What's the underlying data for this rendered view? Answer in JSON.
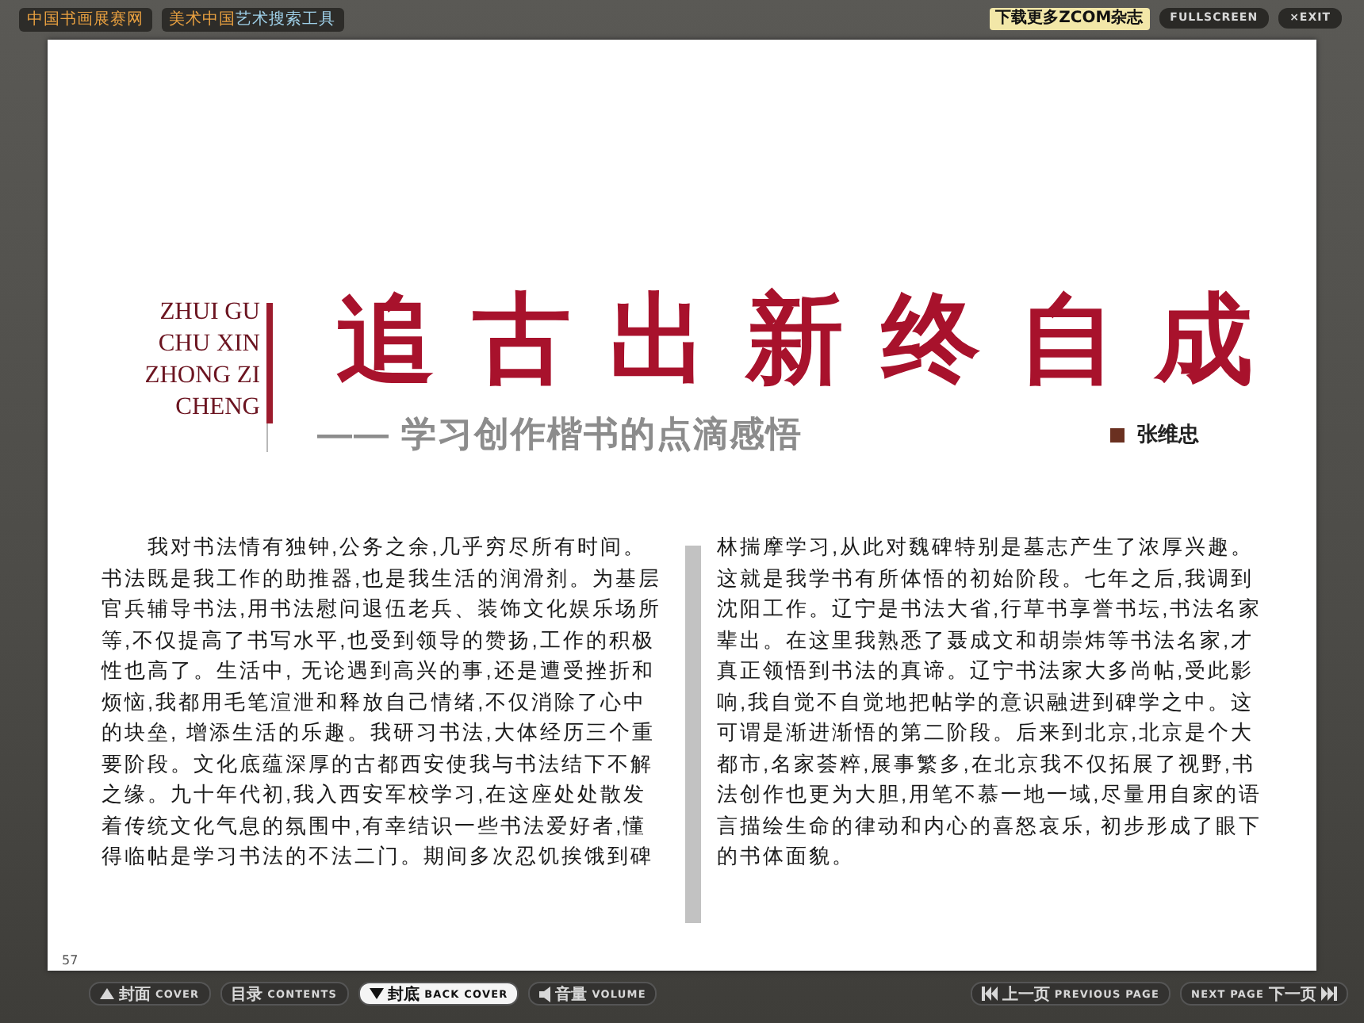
{
  "top_bar": {
    "left_links": [
      {
        "parts": [
          {
            "text": "中国书画展赛网",
            "color": "#e8a040"
          }
        ]
      },
      {
        "parts": [
          {
            "text": "美术中国",
            "color": "#e8a040"
          },
          {
            "text": "艺术搜索工具",
            "color": "#9fd0e8"
          }
        ]
      }
    ],
    "right_links": [
      {
        "label": "下载更多ZCOM杂志",
        "kind": "highlight"
      },
      {
        "label": "FULLSCREEN",
        "kind": "plain"
      },
      {
        "label": "×EXIT",
        "kind": "plain"
      }
    ]
  },
  "article": {
    "title_pinyin": [
      "ZHUI GU",
      "CHU XIN",
      "ZHONG ZI",
      "CHENG"
    ],
    "title": "追古出新终自成",
    "subtitle": "—— 学习创作楷书的点滴感悟",
    "author": "张维忠",
    "columns": [
      {
        "lines": [
          "我对书法情有独钟,公务之余,几乎穷尽所有时间。",
          "书法既是我工作的助推器,也是我生活的润滑剂。为基层",
          "官兵辅导书法,用书法慰问退伍老兵、装饰文化娱乐场所",
          "等,不仅提高了书写水平,也受到领导的赞扬,工作的积极",
          "性也高了。生活中, 无论遇到高兴的事,还是遭受挫折和",
          "烦恼,我都用毛笔渲泄和释放自己情绪,不仅消除了心中",
          "的块垒, 增添生活的乐趣。我研习书法,大体经历三个重",
          "要阶段。文化底蕴深厚的古都西安使我与书法结下不解",
          "之缘。九十年代初,我入西安军校学习,在这座处处散发",
          "着传统文化气息的氛围中,有幸结识一些书法爱好者,懂",
          "得临帖是学习书法的不法二门。期间多次忍饥挨饿到碑"
        ]
      },
      {
        "lines": [
          "林揣摩学习,从此对魏碑特别是墓志产生了浓厚兴趣。",
          "这就是我学书有所体悟的初始阶段。七年之后,我调到",
          "沈阳工作。辽宁是书法大省,行草书享誉书坛,书法名家",
          "辈出。在这里我熟悉了聂成文和胡崇炜等书法名家,才",
          "真正领悟到书法的真谛。辽宁书法家大多尚帖,受此影",
          "响,我自觉不自觉地把帖学的意识融进到碑学之中。这",
          "可谓是渐进渐悟的第二阶段。后来到北京,北京是个大",
          "都市,名家荟粹,展事繁多,在北京我不仅拓展了视野,书",
          "法创作也更为大胆,用笔不慕一地一域,尽量用自家的语",
          "言描绘生命的律动和内心的喜怒哀乐, 初步形成了眼下",
          "的书体面貌。"
        ]
      }
    ],
    "page_number": "57"
  },
  "bottom_nav": [
    {
      "kind": "up",
      "cn": "封面",
      "en": "COVER",
      "selected": false
    },
    {
      "kind": "plain",
      "cn": "目录",
      "en": "CONTENTS",
      "selected": false
    },
    {
      "kind": "down",
      "cn": "封底",
      "en": "BACK COVER",
      "selected": true
    },
    {
      "kind": "volume",
      "cn": "音量",
      "en": "VOLUME",
      "selected": false
    },
    {
      "kind": "previous",
      "cn": "上一页",
      "en": "PREVIOUS PAGE",
      "selected": false
    },
    {
      "kind": "next",
      "cn": "下一页",
      "en": "NEXT PAGE",
      "selected": false
    }
  ]
}
